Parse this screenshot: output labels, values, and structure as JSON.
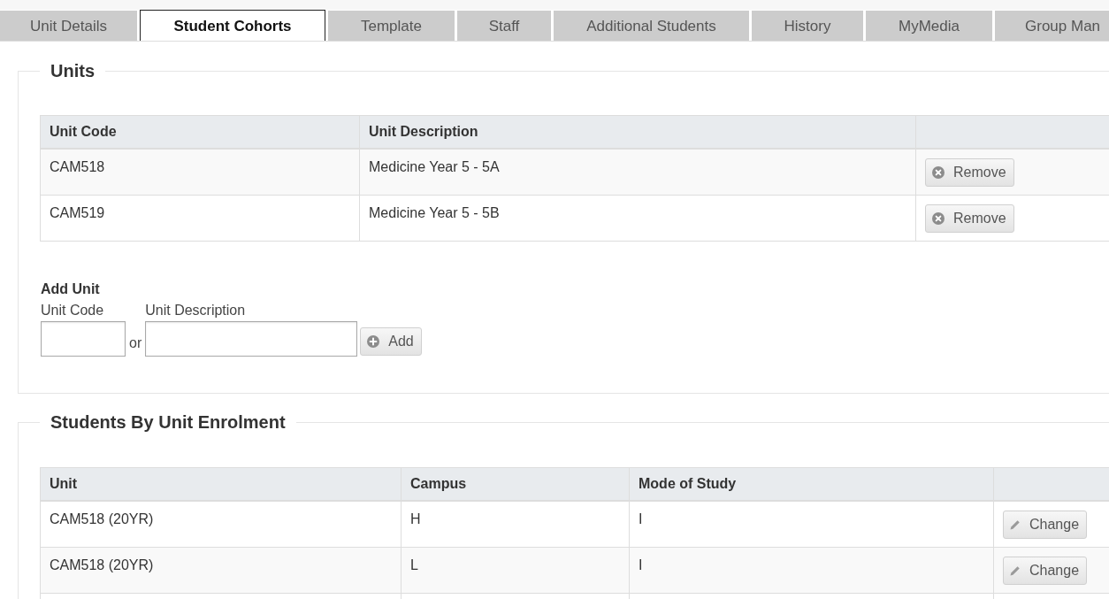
{
  "tabs": [
    {
      "label": "Unit Details",
      "selected": false
    },
    {
      "label": "Student Cohorts",
      "selected": true
    },
    {
      "label": "Template",
      "selected": false
    },
    {
      "label": "Staff",
      "selected": false
    },
    {
      "label": "Additional Students",
      "selected": false
    },
    {
      "label": "History",
      "selected": false
    },
    {
      "label": "MyMedia",
      "selected": false
    },
    {
      "label": "Group Man",
      "selected": false
    }
  ],
  "units": {
    "legend": "Units",
    "table": {
      "columns": [
        "Unit Code",
        "Unit Description"
      ],
      "rows": [
        {
          "cells": [
            "CAM518",
            "Medicine Year 5 - 5A"
          ],
          "action": {
            "kind": "remove",
            "label": "Remove"
          }
        },
        {
          "cells": [
            "CAM519",
            "Medicine Year 5 - 5B"
          ],
          "action": {
            "kind": "remove",
            "label": "Remove"
          }
        }
      ]
    },
    "add_unit": {
      "title": "Add Unit",
      "unit_code": {
        "label": "Unit Code"
      },
      "unit_description": {
        "label": "Unit Description"
      },
      "separator": "or",
      "button": {
        "kind": "add",
        "label": "Add"
      }
    }
  },
  "students_by_unit_enrolment": {
    "legend": "Students By Unit Enrolment",
    "table": {
      "columns": [
        "Unit",
        "Campus",
        "Mode of Study"
      ],
      "rows": [
        {
          "cells": [
            "CAM518 (20YR)",
            "H",
            "I"
          ],
          "action": {
            "kind": "change",
            "label": "Change"
          }
        },
        {
          "cells": [
            "CAM518 (20YR)",
            "L",
            "I"
          ],
          "action": {
            "kind": "change",
            "label": "Change"
          }
        }
      ]
    }
  }
}
